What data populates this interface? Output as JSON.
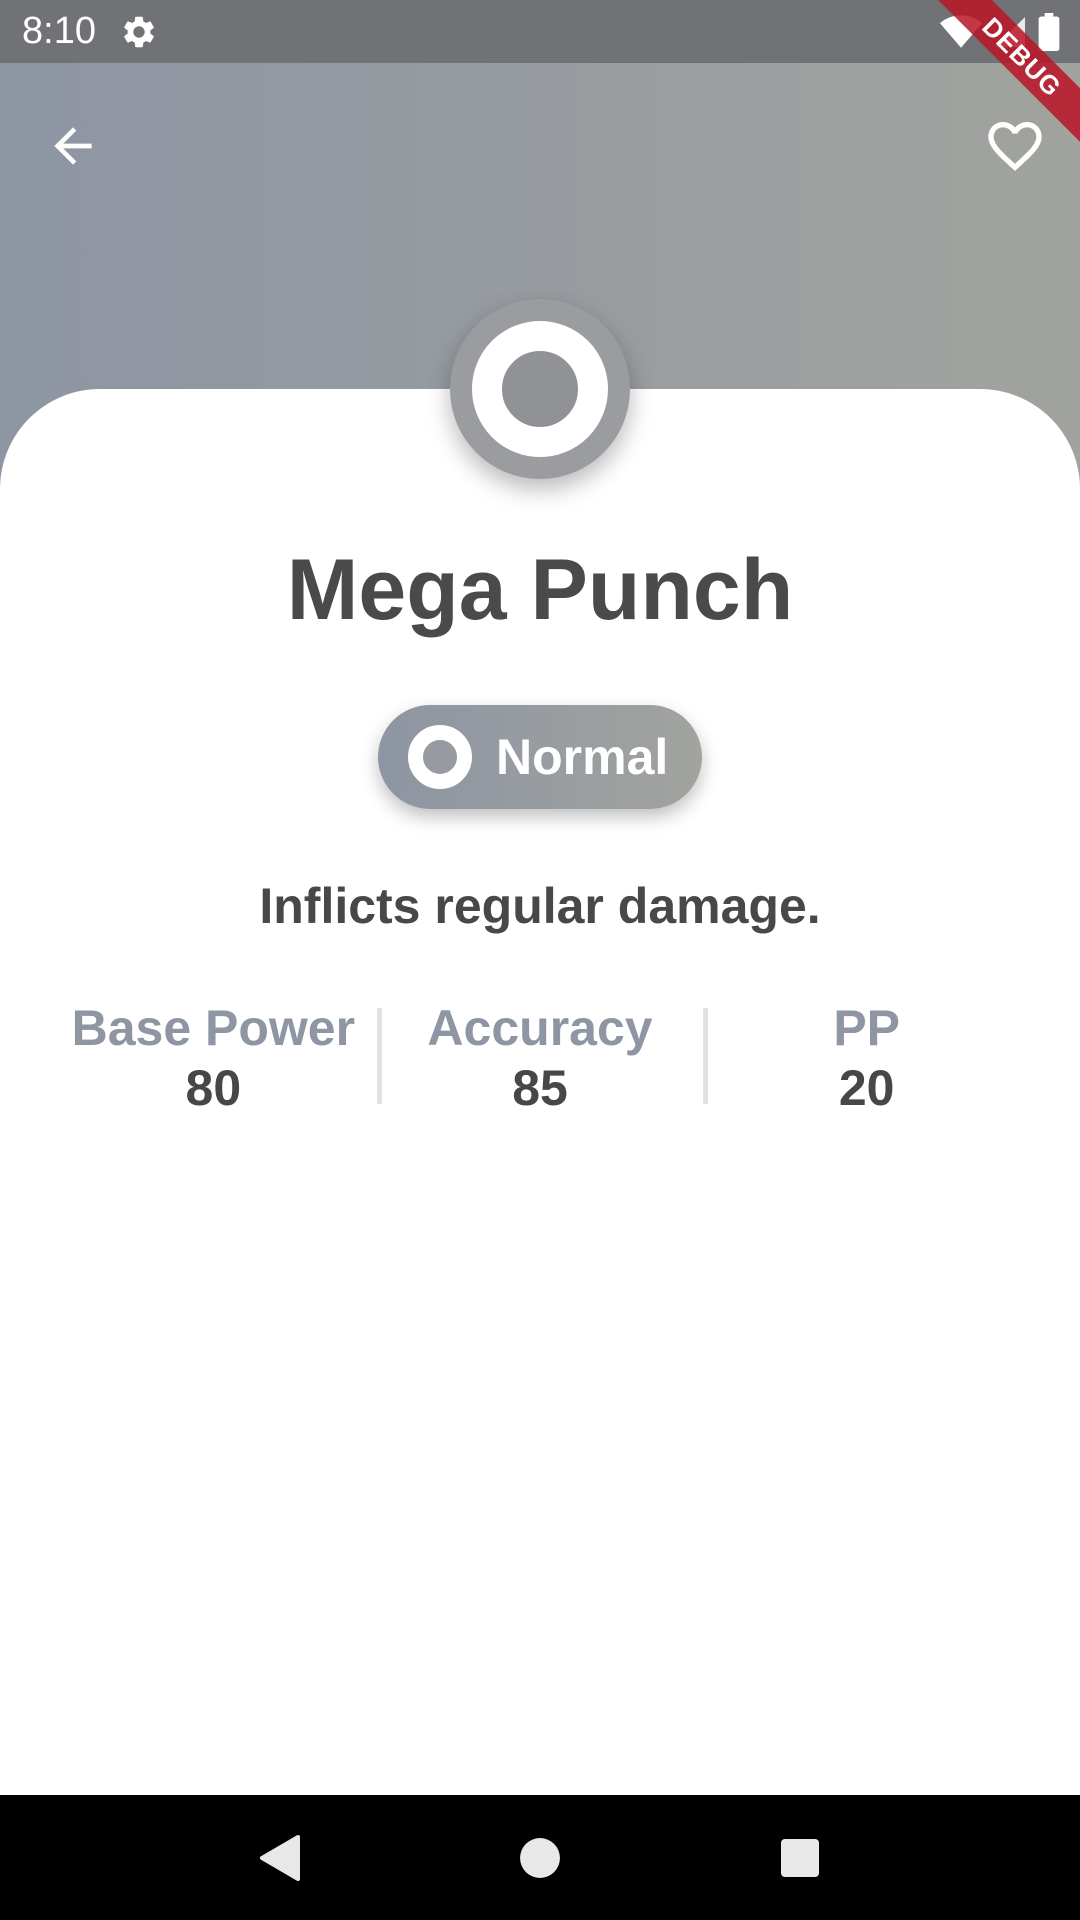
{
  "status_bar": {
    "time": "8:10",
    "icons": [
      "settings-icon",
      "wifi-icon",
      "signal-icon",
      "battery-icon"
    ]
  },
  "header": {
    "back_icon": "arrow-back-icon",
    "favorite_icon": "heart-outline-icon",
    "gradient_start": "#8e95a3",
    "gradient_end": "#a1a39e"
  },
  "debug_banner": {
    "label": "DEBUG",
    "color": "#b81426"
  },
  "move": {
    "name": "Mega Punch",
    "type": "Normal",
    "type_icon": "normal-type-icon",
    "description": "Inflicts regular damage."
  },
  "stats": [
    {
      "label": "Base Power",
      "value": "80"
    },
    {
      "label": "Accuracy",
      "value": "85"
    },
    {
      "label": "PP",
      "value": "20"
    }
  ],
  "nav_bar": {
    "icons": [
      "back-triangle-icon",
      "home-circle-icon",
      "recents-square-icon"
    ]
  }
}
